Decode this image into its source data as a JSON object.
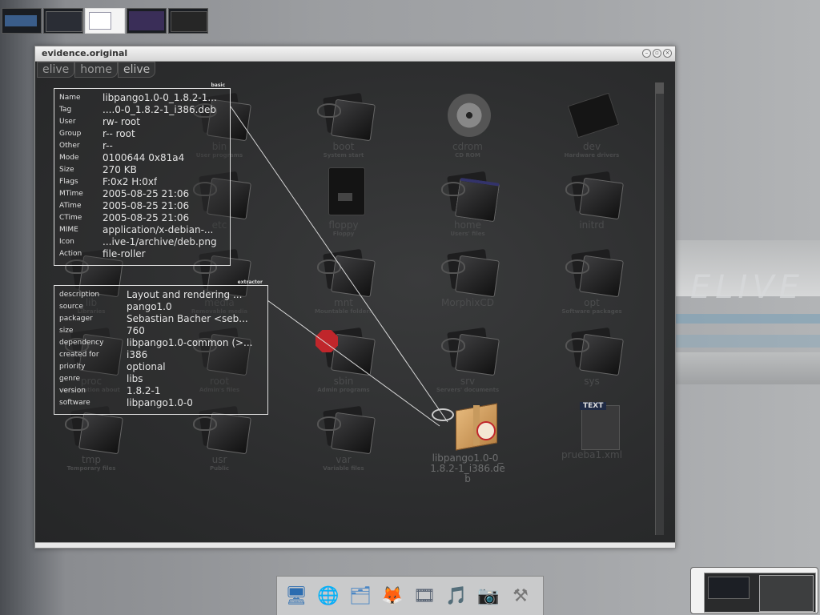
{
  "window": {
    "title": "evidence.original",
    "buttons": [
      "minimize-icon",
      "restore-icon",
      "close-icon"
    ]
  },
  "breadcrumb": [
    "elive",
    "home",
    "elive"
  ],
  "items": [
    {
      "name": "bin",
      "sub": "User programs"
    },
    {
      "name": "boot",
      "sub": "System start"
    },
    {
      "name": "cdrom",
      "sub": "CD ROM"
    },
    {
      "name": "dev",
      "sub": "Hardware drivers"
    },
    {
      "name": "etc",
      "sub": ""
    },
    {
      "name": "floppy",
      "sub": "Floppy"
    },
    {
      "name": "home",
      "sub": "Users' files"
    },
    {
      "name": "initrd",
      "sub": ""
    },
    {
      "name": "lib",
      "sub": "Libraries"
    },
    {
      "name": "media",
      "sub": "Removable media"
    },
    {
      "name": "mnt",
      "sub": "Mountable folders"
    },
    {
      "name": "MorphixCD",
      "sub": ""
    },
    {
      "name": "opt",
      "sub": "Software packages"
    },
    {
      "name": "proc",
      "sub": "Information about"
    },
    {
      "name": "root",
      "sub": "Admin's files"
    },
    {
      "name": "sbin",
      "sub": "Admin programs"
    },
    {
      "name": "srv",
      "sub": "Servers' documents"
    },
    {
      "name": "sys",
      "sub": ""
    },
    {
      "name": "tmp",
      "sub": "Temporary files"
    },
    {
      "name": "usr",
      "sub": "Public"
    },
    {
      "name": "var",
      "sub": "Variable files"
    },
    {
      "name": "libpango1.0-0_1.8.2-1_i386.deb",
      "sub": ""
    },
    {
      "name": "prueba1.xml",
      "sub": ""
    }
  ],
  "text_badge": "TEXT",
  "basic_panel": {
    "tag": "basic",
    "rows": [
      {
        "k": "Name",
        "v": "libpango1.0-0_1.8.2-1..."
      },
      {
        "k": "Tag",
        "v": "....0-0_1.8.2-1_i386.deb"
      },
      {
        "k": "User",
        "v": "rw- root"
      },
      {
        "k": "Group",
        "v": "r-- root"
      },
      {
        "k": "Other",
        "v": "r--"
      },
      {
        "k": "Mode",
        "v": "0100644 0x81a4"
      },
      {
        "k": "Size",
        "v": "270 KB"
      },
      {
        "k": "Flags",
        "v": "F:0x2 H:0xf"
      },
      {
        "k": "MTime",
        "v": "2005-08-25 21:06"
      },
      {
        "k": "ATime",
        "v": "2005-08-25 21:06"
      },
      {
        "k": "CTime",
        "v": "2005-08-25 21:06"
      },
      {
        "k": "MIME",
        "v": "application/x-debian-..."
      },
      {
        "k": "Icon",
        "v": "...ive-1/archive/deb.png"
      },
      {
        "k": "Action",
        "v": "file-roller"
      }
    ]
  },
  "extractor_panel": {
    "tag": "extractor",
    "rows": [
      {
        "k": "description",
        "v": "Layout and rendering ..."
      },
      {
        "k": "source",
        "v": "pango1.0"
      },
      {
        "k": "packager",
        "v": "Sebastian Bacher <seb..."
      },
      {
        "k": "size",
        "v": "760"
      },
      {
        "k": "dependency",
        "v": "libpango1.0-common (>..."
      },
      {
        "k": "created for",
        "v": "i386"
      },
      {
        "k": "priority",
        "v": "optional"
      },
      {
        "k": "genre",
        "v": "libs"
      },
      {
        "k": "version",
        "v": "1.8.2-1"
      },
      {
        "k": "software",
        "v": "libpango1.0-0"
      }
    ]
  },
  "wallpaper_logo": "ELIVE",
  "dock": [
    {
      "icon": "monitor-icon",
      "glyph": "🖥"
    },
    {
      "icon": "network-globe-icon",
      "glyph": "🌐"
    },
    {
      "icon": "file-manager-icon",
      "glyph": "🗂"
    },
    {
      "icon": "firefox-icon",
      "glyph": "🦊"
    },
    {
      "icon": "video-player-icon",
      "glyph": "🎞"
    },
    {
      "icon": "music-player-icon",
      "glyph": "🎵"
    },
    {
      "icon": "camera-icon",
      "glyph": "📷"
    },
    {
      "icon": "tools-icon",
      "glyph": "⚒"
    }
  ],
  "colors": {
    "panel_border": "#dddddd",
    "window_bg": "#2b2c2d",
    "desktop": "#9c9ea1"
  }
}
